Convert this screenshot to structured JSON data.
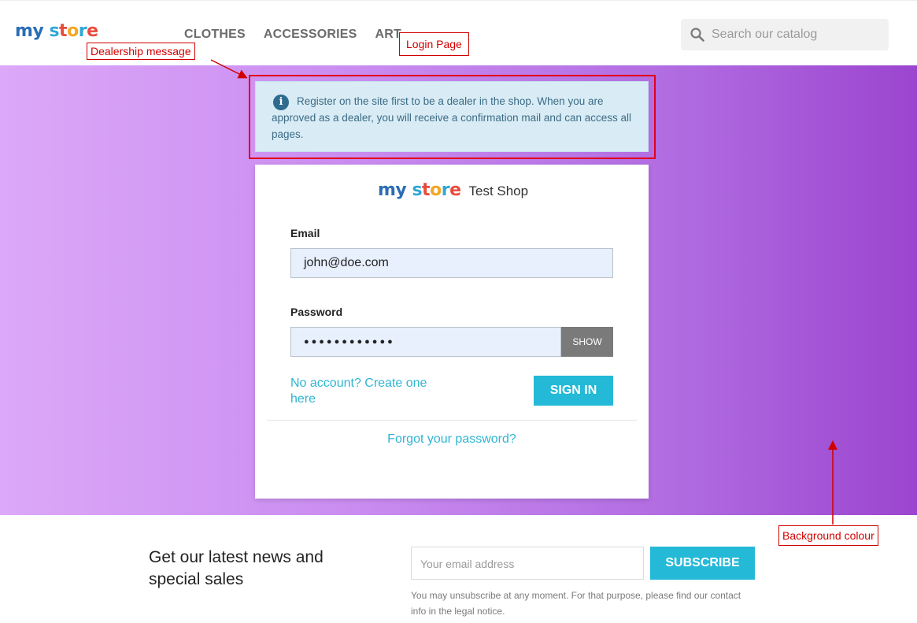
{
  "header": {
    "logo": {
      "my": "my",
      "store": "store"
    },
    "nav": [
      "CLOTHES",
      "ACCESSORIES",
      "ART"
    ],
    "search_placeholder": "Search our catalog"
  },
  "alert": {
    "text": "Register on the site first to be a dealer in the shop. When you are approved as a dealer, you will receive a confirmation mail and can access all pages."
  },
  "login": {
    "brand_logo": "my store",
    "shop_name": "Test Shop",
    "email_label": "Email",
    "email_value": "john@doe.com",
    "password_label": "Password",
    "password_value": "●●●●●●●●●●●●",
    "show_label": "SHOW",
    "create_account": "No account? Create one here",
    "sign_in": "SIGN IN",
    "forgot": "Forgot your password?"
  },
  "newsletter": {
    "title": "Get our latest news and special sales",
    "email_placeholder": "Your email address",
    "subscribe": "SUBSCRIBE",
    "note": "You may unsubscribe at any moment. For that purpose, please find our contact info in the legal notice."
  },
  "annotations": {
    "dealership": "Dealership message",
    "login_page": "Login Page",
    "background": "Background colour"
  },
  "colors": {
    "accent": "#24b9d7",
    "annotation": "#d10000",
    "gradient_start": "#dca8f8",
    "gradient_end": "#9b45cf"
  }
}
